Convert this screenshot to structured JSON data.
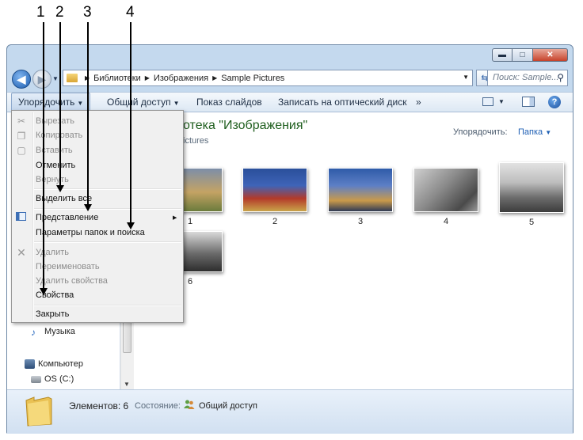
{
  "annotations": [
    "1",
    "2",
    "3",
    "4"
  ],
  "window": {
    "controls": {
      "minimize": "▬",
      "maximize": "□",
      "close": "✕"
    }
  },
  "address_bar": {
    "segments": [
      "Библиотеки",
      "Изображения",
      "Sample Pictures"
    ],
    "search_placeholder": "Поиск: Sample..."
  },
  "toolbar": {
    "organize": "Упорядочить",
    "share": "Общий доступ",
    "slideshow": "Показ слайдов",
    "burn": "Записать на оптический диск",
    "more": "»"
  },
  "library": {
    "title": "Библиотека \"Изображения\"",
    "title_visible": "отека \"Изображения\"",
    "subtitle_visible": "ictures",
    "arrange_label": "Упорядочить:",
    "arrange_value": "Папка"
  },
  "thumbnails": [
    "1",
    "2",
    "3",
    "4",
    "5",
    "6"
  ],
  "nav_pane": {
    "music": "Музыка",
    "computer": "Компьютер",
    "drive": "OS (C:)"
  },
  "context_menu": {
    "cut": "Вырезать",
    "copy": "Копировать",
    "paste": "Вставить",
    "undo": "Отменить",
    "redo": "Вернуть",
    "select_all": "Выделить все",
    "view": "Представление",
    "folder_options": "Параметры папок и поиска",
    "delete": "Удалить",
    "rename": "Переименовать",
    "remove_properties": "Удалить свойства",
    "properties": "Свойства",
    "close": "Закрыть"
  },
  "status": {
    "count": "Элементов: 6",
    "state_label": "Состояние:",
    "state_value": "Общий доступ"
  },
  "colors": {
    "library_title": "#1f5e1e",
    "link_blue": "#1e5fb4",
    "window_frame": "#c4d9ee"
  }
}
